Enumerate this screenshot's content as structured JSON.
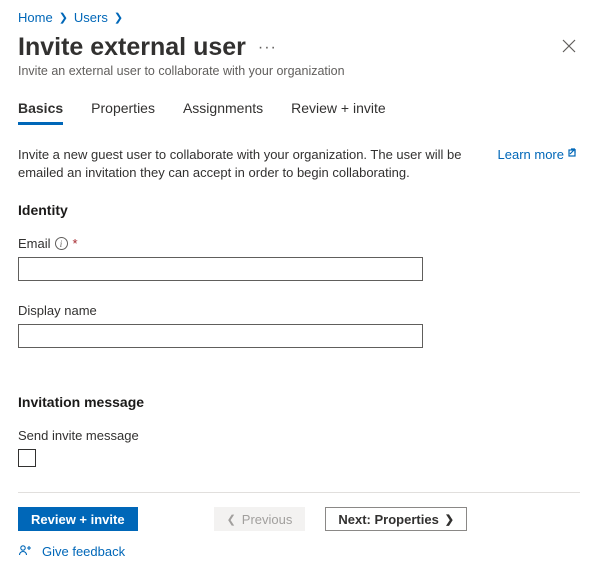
{
  "breadcrumb": {
    "items": [
      {
        "label": "Home"
      },
      {
        "label": "Users"
      }
    ]
  },
  "header": {
    "title": "Invite external user",
    "subtitle": "Invite an external user to collaborate with your organization"
  },
  "tabs": [
    {
      "label": "Basics",
      "active": true
    },
    {
      "label": "Properties",
      "active": false
    },
    {
      "label": "Assignments",
      "active": false
    },
    {
      "label": "Review + invite",
      "active": false
    }
  ],
  "description": "Invite a new guest user to collaborate with your organization. The user will be emailed an invitation they can accept in order to begin collaborating.",
  "learn_more": "Learn more",
  "sections": {
    "identity": {
      "heading": "Identity",
      "email_label": "Email",
      "email_value": "",
      "display_name_label": "Display name",
      "display_name_value": ""
    },
    "invitation": {
      "heading": "Invitation message",
      "send_label": "Send invite message",
      "send_checked": false
    }
  },
  "footer": {
    "review_label": "Review + invite",
    "prev_label": "Previous",
    "next_label": "Next: Properties",
    "feedback_label": "Give feedback"
  }
}
